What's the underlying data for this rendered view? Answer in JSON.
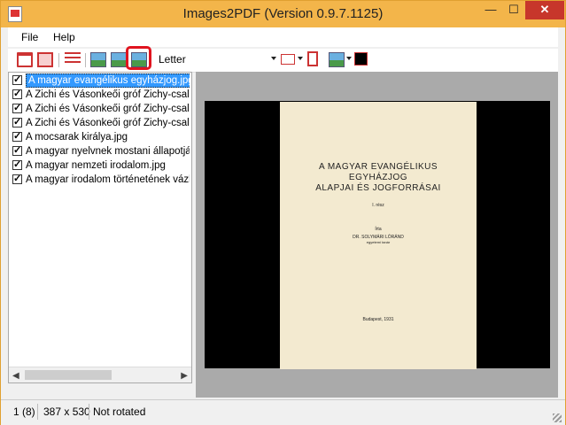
{
  "window": {
    "title": "Images2PDF (Version 0.9.7.1125)",
    "minimize": "—",
    "maximize": "☐",
    "close": "✕"
  },
  "menu": [
    "File",
    "Help"
  ],
  "toolbar": {
    "page_size": "Letter",
    "icons": [
      "open-folder-icon",
      "print-icon",
      "checklist-icon",
      "image-icon",
      "image-fit-icon",
      "image-fill-icon",
      "landscape-icon",
      "portrait-icon",
      "image-position-icon",
      "color-swatch-icon"
    ],
    "accent": "#e0141f"
  },
  "file_list": [
    {
      "label": "A magyar evangélikus egyházjog.jpg",
      "checked": true,
      "selected": true
    },
    {
      "label": "A Zichi és Vásonkeői gróf Zichy-család",
      "checked": true
    },
    {
      "label": "A Zichi és Vásonkeői gróf Zichy-család",
      "checked": true
    },
    {
      "label": "A Zichi és Vásonkeői gróf Zichy-család",
      "checked": true
    },
    {
      "label": "A mocsarak királya.jpg",
      "checked": true
    },
    {
      "label": "A magyar nyelvnek mostani állapotjáról l",
      "checked": true
    },
    {
      "label": "A magyar nemzeti irodalom.jpg",
      "checked": true
    },
    {
      "label": "A magyar irodalom történetének vázlata",
      "checked": true
    }
  ],
  "preview": {
    "title_line1": "A MAGYAR EVANGÉLIKUS",
    "title_line2": "EGYHÁZJOG",
    "title_line3": "ALAPJAI ÉS JOGFORRÁSAI",
    "volume": "I. rész",
    "irta": "Írta",
    "author": "DR. SOLYMÁRI LÓRÁND",
    "affiliation": "egyetemi tanár",
    "place": "Budapest, 1931"
  },
  "status": {
    "page": "1 (8)",
    "size": "387 x 530",
    "rotation": "Not rotated"
  },
  "colors": {
    "titlebar": "#f3b54a",
    "selection": "#3399ff",
    "close": "#c7362b"
  }
}
